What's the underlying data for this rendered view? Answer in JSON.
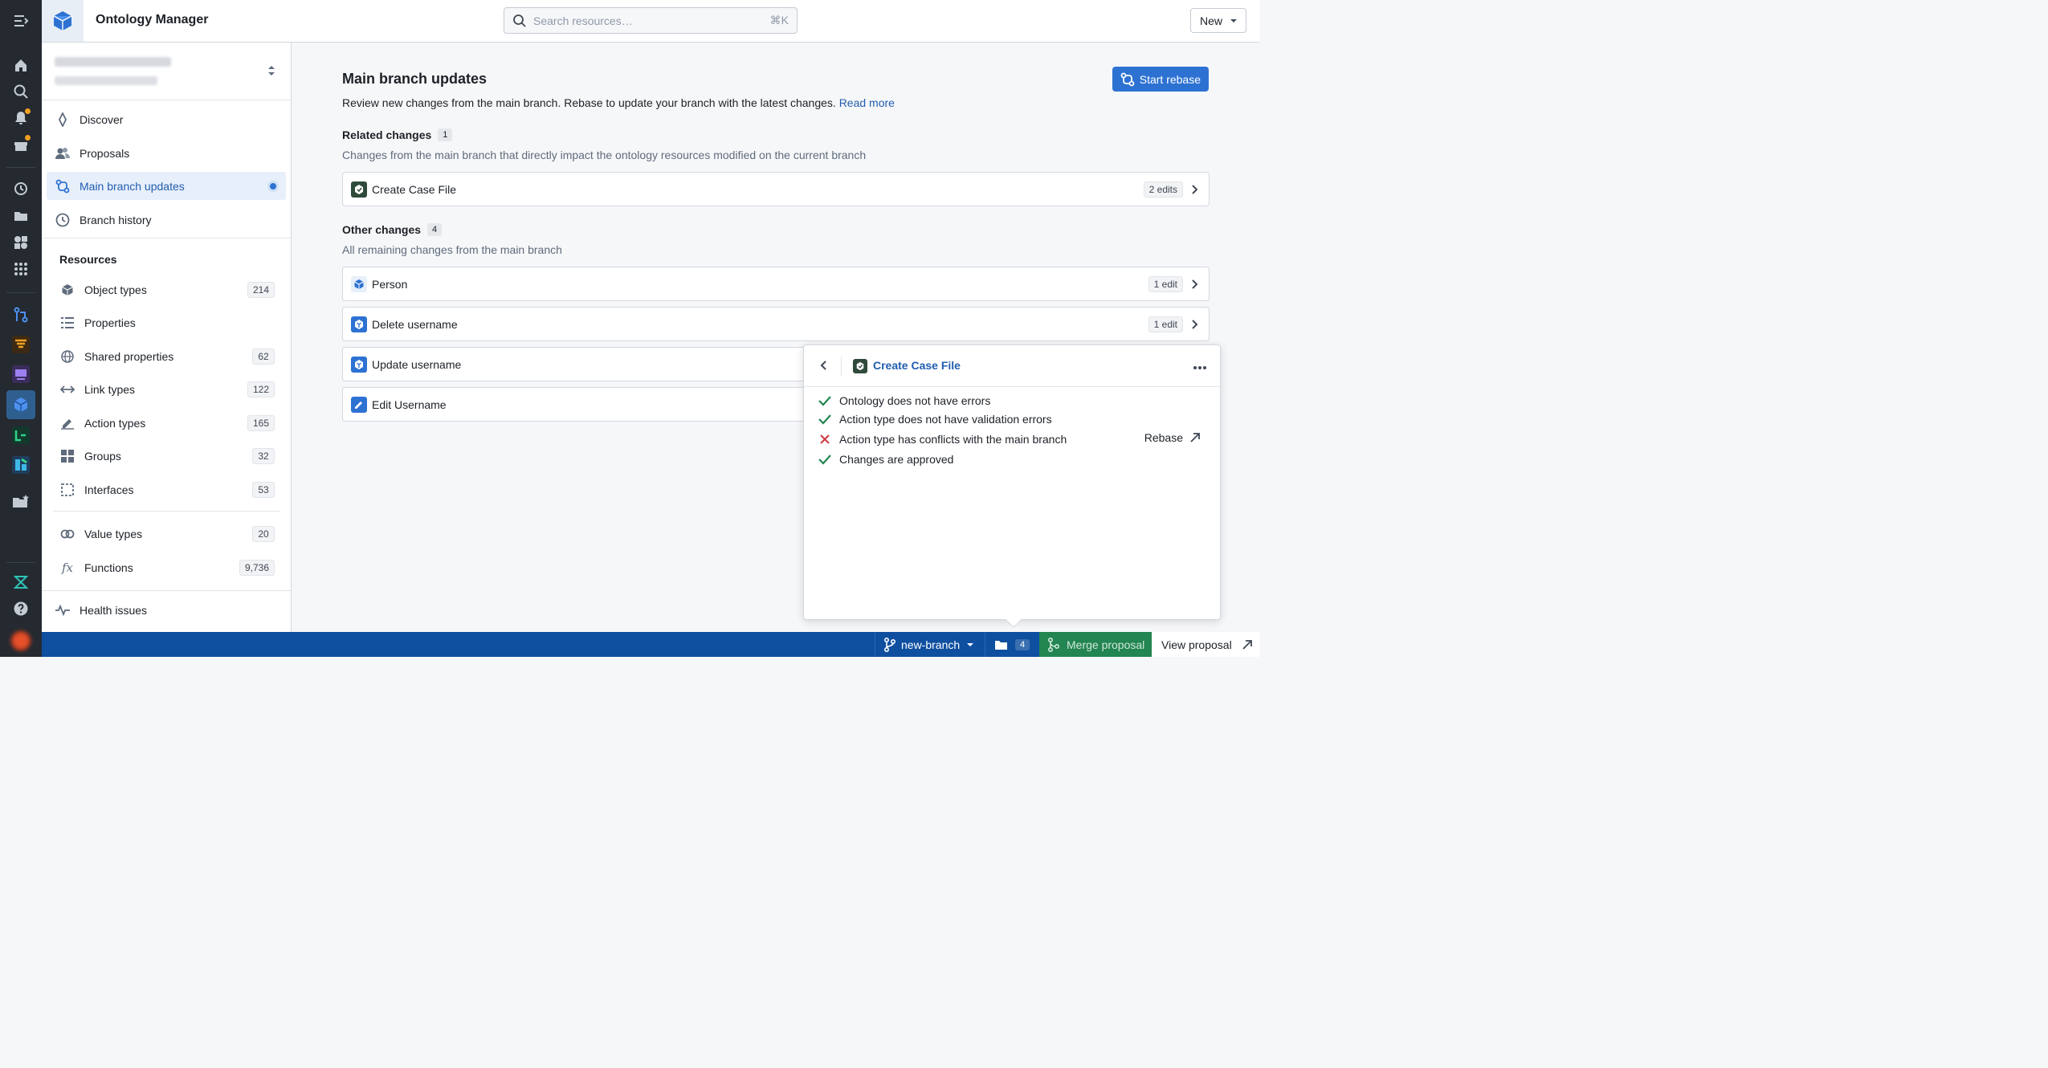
{
  "header": {
    "app_title": "Ontology Manager",
    "search_placeholder": "Search resources…",
    "search_shortcut": "⌘K",
    "new_label": "New"
  },
  "sidebar": {
    "nav": [
      {
        "label": "Discover",
        "icon": "compass-icon"
      },
      {
        "label": "Proposals",
        "icon": "people-icon"
      },
      {
        "label": "Main branch updates",
        "icon": "rebase-icon"
      },
      {
        "label": "Branch history",
        "icon": "clock-icon"
      }
    ],
    "resources_title": "Resources",
    "resources": [
      {
        "label": "Object types",
        "count": "214"
      },
      {
        "label": "Properties",
        "count": ""
      },
      {
        "label": "Shared properties",
        "count": "62"
      },
      {
        "label": "Link types",
        "count": "122"
      },
      {
        "label": "Action types",
        "count": "165"
      },
      {
        "label": "Groups",
        "count": "32"
      },
      {
        "label": "Interfaces",
        "count": "53"
      },
      {
        "label": "Value types",
        "count": "20"
      },
      {
        "label": "Functions",
        "count": "9,736"
      }
    ],
    "health": "Health issues"
  },
  "main": {
    "title": "Main branch updates",
    "description": "Review new changes from the main branch. Rebase to update your branch with the latest changes.",
    "read_more": "Read more",
    "start_rebase": "Start rebase",
    "related": {
      "title": "Related changes",
      "count": "1",
      "description": "Changes from the main branch that directly impact the ontology resources modified on the current branch",
      "rows": [
        {
          "label": "Create Case File",
          "edits": "2 edits"
        }
      ]
    },
    "other": {
      "title": "Other changes",
      "count": "4",
      "description": "All remaining changes from the main branch",
      "rows": [
        {
          "label": "Person",
          "edits": "1 edit"
        },
        {
          "label": "Delete username",
          "edits": "1 edit"
        },
        {
          "label": "Update username",
          "edits": ""
        },
        {
          "label": "Edit Username",
          "edits": ""
        }
      ]
    }
  },
  "popover": {
    "title": "Create Case File",
    "checks": [
      {
        "label": "Ontology does not have errors",
        "status": "pass"
      },
      {
        "label": "Action type does not have validation errors",
        "status": "pass"
      },
      {
        "label": "Action type has conflicts with the main branch",
        "status": "fail"
      },
      {
        "label": "Changes are approved",
        "status": "pass"
      }
    ],
    "rebase_label": "Rebase"
  },
  "bottombar": {
    "branch": "new-branch",
    "folder_count": "4",
    "merge": "Merge proposal",
    "view": "View proposal"
  },
  "colors": {
    "accent": "#2d72d2",
    "success": "#238551",
    "danger": "#cd4246",
    "bar": "#0f4fa0"
  }
}
